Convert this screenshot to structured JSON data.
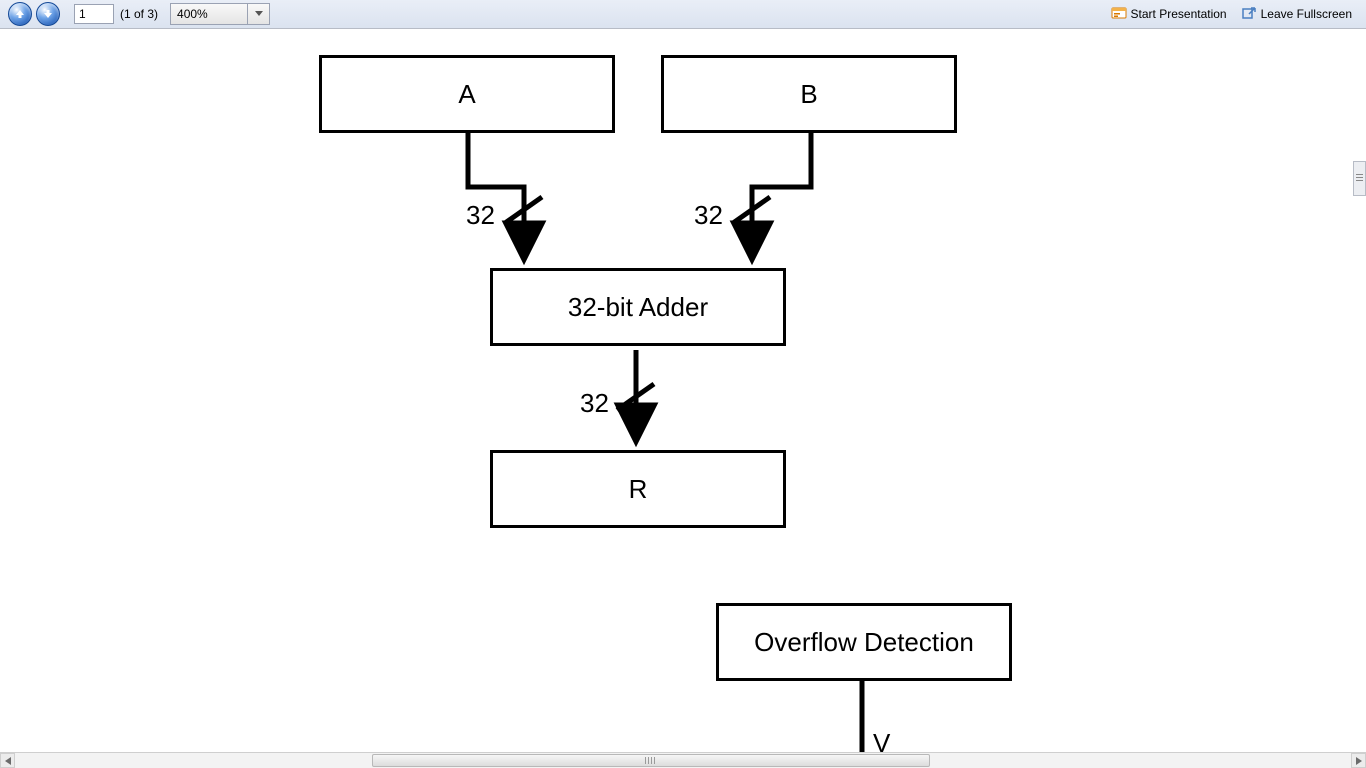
{
  "toolbar": {
    "page_input_value": "1",
    "page_count_text": "(1 of 3)",
    "zoom_value": "400%",
    "start_presentation_label": "Start Presentation",
    "leave_fullscreen_label": "Leave Fullscreen"
  },
  "diagram": {
    "block_a": "A",
    "block_b": "B",
    "adder": "32-bit Adder",
    "block_r": "R",
    "overflow": "Overflow Detection",
    "output_v": "V",
    "bus_a": "32",
    "bus_b": "32",
    "bus_r": "32"
  }
}
